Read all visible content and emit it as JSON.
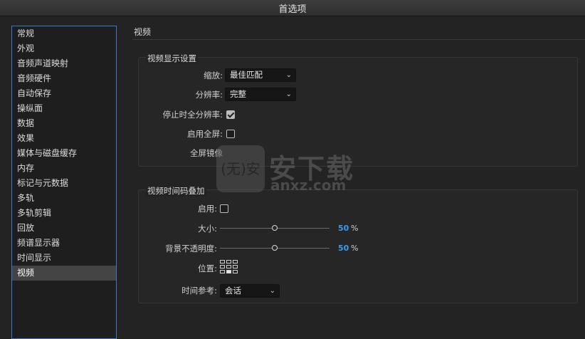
{
  "window": {
    "title": "首选项"
  },
  "sidebar": {
    "items": [
      {
        "label": "常规"
      },
      {
        "label": "外观"
      },
      {
        "label": "音频声道映射"
      },
      {
        "label": "音频硬件"
      },
      {
        "label": "自动保存"
      },
      {
        "label": "操纵面"
      },
      {
        "label": "数据"
      },
      {
        "label": "效果"
      },
      {
        "label": "媒体与磁盘缓存"
      },
      {
        "label": "内存"
      },
      {
        "label": "标记与元数据"
      },
      {
        "label": "多轨"
      },
      {
        "label": "多轨剪辑"
      },
      {
        "label": "回放"
      },
      {
        "label": "频谱显示器"
      },
      {
        "label": "时间显示"
      },
      {
        "label": "视频"
      }
    ],
    "selected_index": 16
  },
  "main": {
    "section_title": "视频",
    "video_display": {
      "title": "视频显示设置",
      "scale_label": "缩放:",
      "scale_value": "最佳匹配",
      "resolution_label": "分辨率:",
      "resolution_value": "完整",
      "full_res_on_stop_label": "停止时全分辨率:",
      "full_res_on_stop_checked": true,
      "fullscreen_label": "启用全屏:",
      "fullscreen_checked": false,
      "fullscreen_mirror_label": "全屏镜像"
    },
    "timecode_overlay": {
      "title": "视频时间码叠加",
      "enable_label": "启用:",
      "enable_checked": false,
      "size_label": "大小:",
      "size_value": "50",
      "size_unit": "%",
      "size_fraction": 0.5,
      "opacity_label": "背景不透明度:",
      "opacity_value": "50",
      "opacity_unit": "%",
      "opacity_fraction": 0.5,
      "position_label": "位置:",
      "position_selected": "bottom-center",
      "time_ref_label": "时间参考:",
      "time_ref_value": "会话"
    }
  },
  "watermark": {
    "badge_text": "(无)安",
    "big_text": "安下载",
    "small_text": "anxz.com"
  },
  "colors": {
    "accent": "#3d9be9",
    "sidebar_border": "#3b78c8",
    "background": "#232323"
  }
}
